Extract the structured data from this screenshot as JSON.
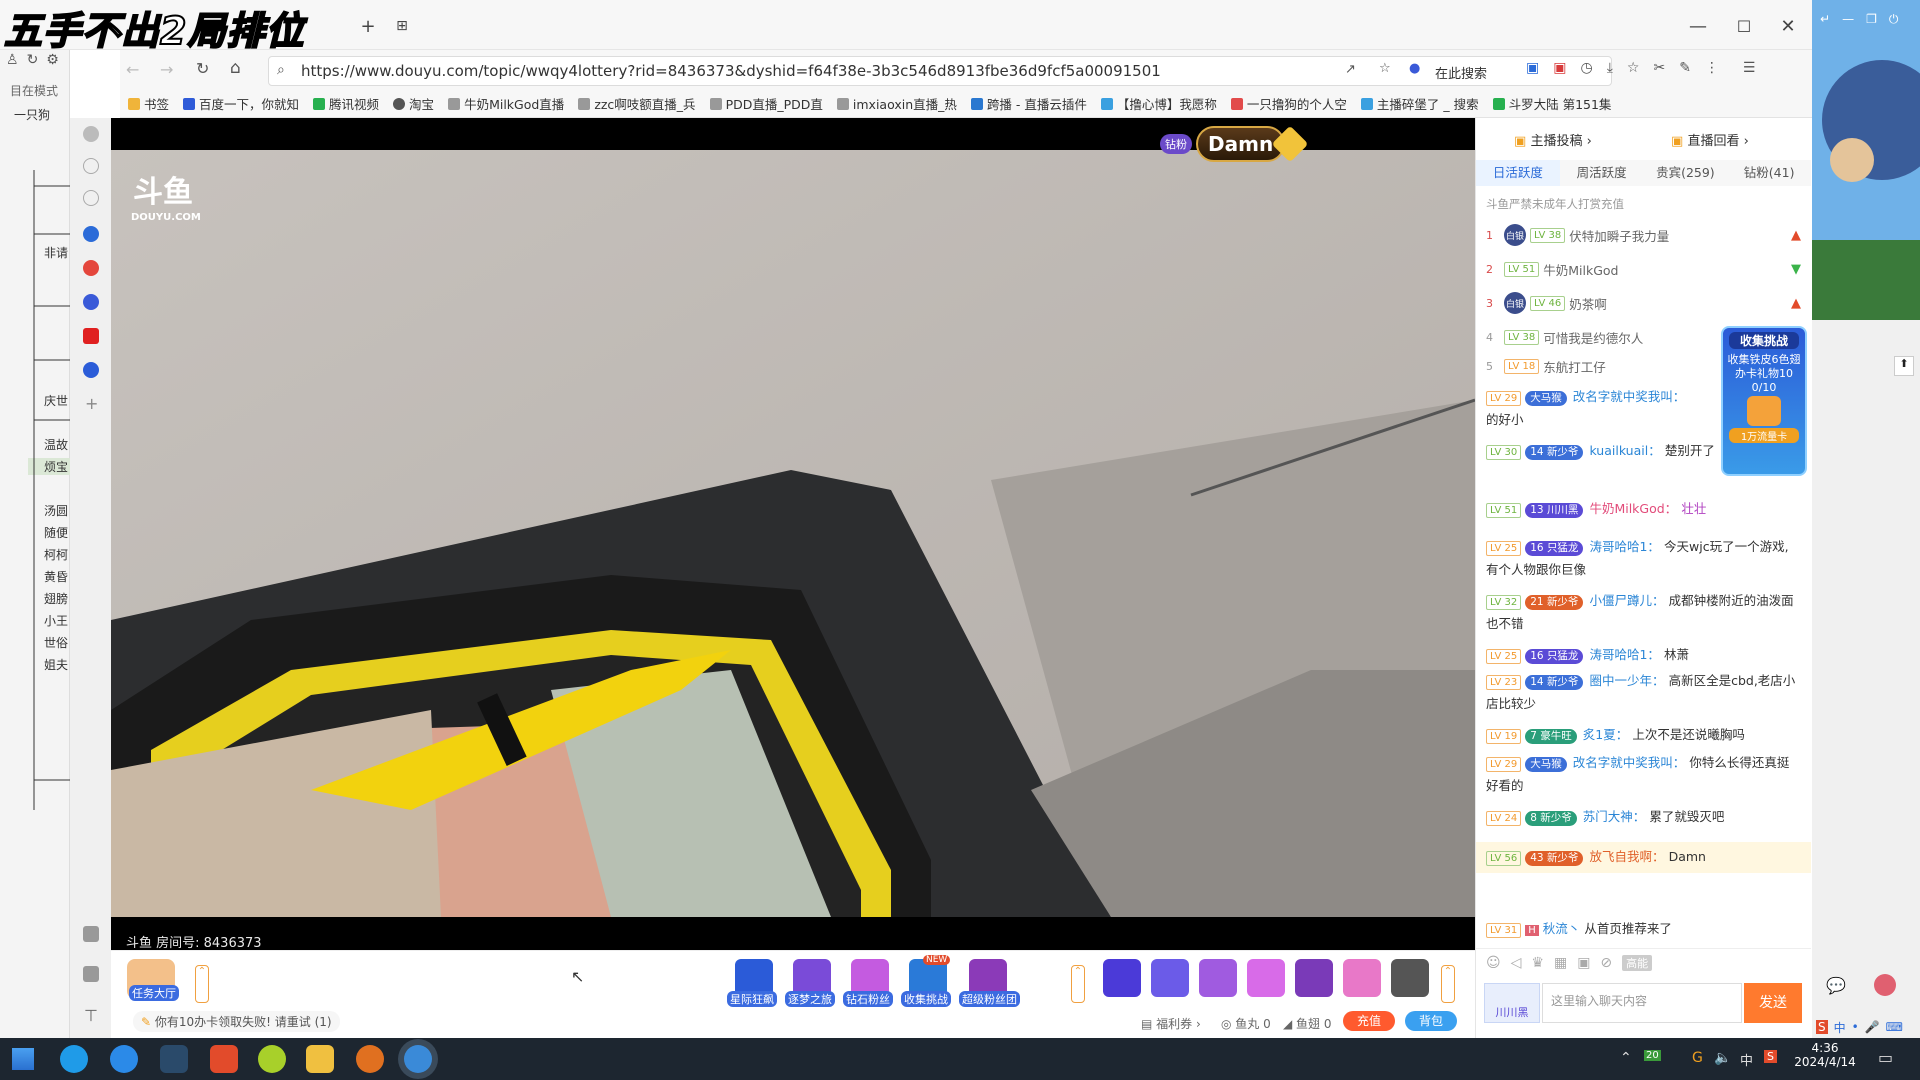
{
  "overlay_title": "五手不出2局排位",
  "browser": {
    "url": "https://www.douyu.com/topic/wwqy4lottery?rid=8436373&dyshid=f64f38e-3b3c546d8913fbe36d9fcf5a00091501",
    "search_label": "在此搜索",
    "bookmarks": [
      "书签",
      "百度一下，你就知",
      "腾讯视频",
      "淘宝",
      "牛奶MilkGod直播",
      "zzc啊吱额直播_兵",
      "PDD直播_PDD直",
      "imxiaoxin直播_热",
      "跨播 - 直播云插件",
      "【撸心博】我愿称",
      "一只撸狗的个人空",
      "主播碎堡了 _ 搜索",
      "斗罗大陆 第151集"
    ]
  },
  "left_panel": {
    "header": "一只狗",
    "mode_label": "目在模式",
    "items": [
      "非请",
      "庆世",
      "温故",
      "烦宝",
      "汤圆",
      "随便",
      "柯柯",
      "黄昏",
      "翅膀",
      "小王",
      "世俗",
      "姐夫"
    ]
  },
  "stream": {
    "logo_big": "斗鱼",
    "logo_small": "DOUYU.COM",
    "room_label": "斗鱼 房间号: 8436373",
    "badge_text": "Damn",
    "rank_badge": "钻粉"
  },
  "chat": {
    "top_links": [
      "主播投稿",
      "直播回看"
    ],
    "tabs": [
      "日活跃度",
      "周活跃度",
      "贵宾(259)",
      "钻粉(41)"
    ],
    "notice": "斗鱼严禁未成年人打赏充值",
    "rank": [
      {
        "n": "1",
        "lv": "LV 38",
        "name": "伏特加瞬子我力量",
        "tag": "白银"
      },
      {
        "n": "2",
        "lv": "LV 51",
        "name": "牛奶MilkGod",
        "tag": ""
      },
      {
        "n": "3",
        "lv": "LV 46",
        "name": "奶茶啊",
        "tag": "白银"
      },
      {
        "n": "4",
        "lv": "LV 38",
        "name": "可惜我是约德尔人",
        "tag": ""
      },
      {
        "n": "5",
        "lv": "LV 18",
        "name": "东航打工仔",
        "tag": ""
      }
    ],
    "messages": [
      {
        "lv": "LV 29",
        "fan": "大马猴",
        "fan_color": "#3c6fd8",
        "user": "改名字就中奖我叫：",
        "text": "的好小"
      },
      {
        "lv": "LV 30",
        "fan": "新少爷",
        "fan_lv": "14",
        "fan_color": "#3c6fd8",
        "user": "kuailkuail：",
        "text": "楚别开了"
      },
      {
        "lv": "LV 51",
        "fan": "川川黑",
        "fan_lv": "13",
        "fan_color": "#5b4bd6",
        "user": "牛奶MilkGod：",
        "text": "壮壮"
      },
      {
        "lv": "LV 25",
        "fan": "只猛龙",
        "fan_lv": "16",
        "fan_color": "#5b4bd6",
        "user": "涛哥哈哈1：",
        "text": "今天wjc玩了一个游戏,有个人物跟你巨像"
      },
      {
        "lv": "LV 32",
        "fan": "新少爷",
        "fan_lv": "21",
        "fan_color": "#e0602a",
        "user": "小僵尸蹲儿：",
        "text": "成都钟楼附近的油泼面也不错"
      },
      {
        "lv": "LV 25",
        "fan": "只猛龙",
        "fan_lv": "16",
        "fan_color": "#5b4bd6",
        "user": "涛哥哈哈1：",
        "text": "林萧"
      },
      {
        "lv": "LV 23",
        "fan": "新少爷",
        "fan_lv": "14",
        "fan_color": "#3c6fd8",
        "user": "圈中一少年：",
        "text": "高新区全是cbd,老店小店比较少"
      },
      {
        "lv": "LV 19",
        "fan": "豪牛旺",
        "fan_lv": "7",
        "fan_color": "#2a9e7a",
        "user": "炙1夏：",
        "text": "上次不是还说曦胸吗"
      },
      {
        "lv": "LV 29",
        "fan": "大马猴",
        "fan_color": "#3c6fd8",
        "user": "改名字就中奖我叫：",
        "text": "你特么长得还真挺好看的"
      },
      {
        "lv": "LV 24",
        "fan": "新少爷",
        "fan_lv": "8",
        "fan_color": "#2a9e7a",
        "user": "苏门大神：",
        "text": "累了就毁灭吧"
      },
      {
        "lv": "LV 56",
        "fan": "新少爷",
        "fan_lv": "43",
        "fan_color": "#e0602a",
        "user": "放飞自我啊：",
        "text": "Damn"
      },
      {
        "lv": "LV 31",
        "fan": "",
        "fan_color": "#e06070",
        "user": "秋流丶",
        "text": "从首页推荐来了"
      }
    ],
    "challenge": {
      "title": "收集挑战",
      "desc": "收集铁皮6色翅办卡礼物10",
      "progress": "0/10",
      "reward": "1万流量卡"
    },
    "input_placeholder": "这里输入聊天内容",
    "send_label": "发送",
    "high_label": "高能",
    "fan_label": "川川黑"
  },
  "bottom": {
    "task_hall": "任务大厅",
    "gifts": [
      "星际狂飙",
      "逐梦之旅",
      "钻石粉丝",
      "收集挑战",
      "超级粉丝团"
    ],
    "new_tag": "NEW",
    "notice": "你有10办卡领取失败! 请重试 (1)",
    "welfare": "福利券",
    "fishball": "鱼丸 0",
    "fishwing": "鱼翅 0",
    "recharge": "充值",
    "backpack": "背包"
  },
  "taskbar": {
    "time": "4:36",
    "date": "2024/4/14",
    "lang": "中",
    "battery": "20"
  }
}
